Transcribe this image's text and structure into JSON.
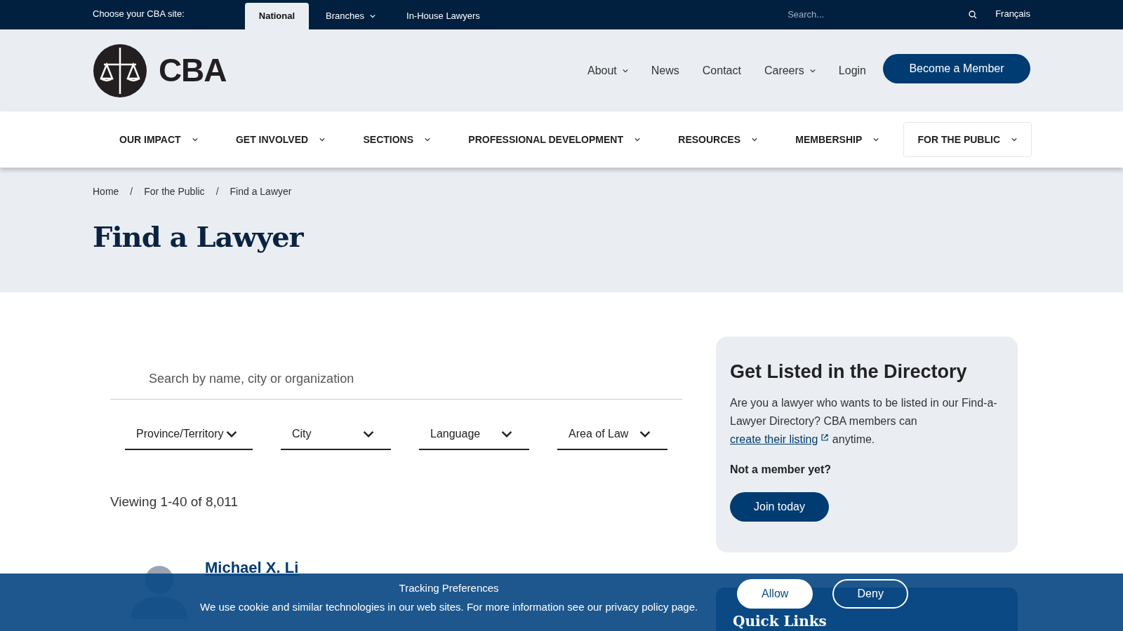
{
  "site_bar": {
    "label": "Choose your CBA site:",
    "sites": [
      {
        "label": "National",
        "selected": true,
        "has_menu": false
      },
      {
        "label": "Branches",
        "selected": false,
        "has_menu": true
      },
      {
        "label": "In-House Lawyers",
        "selected": false,
        "has_menu": false
      }
    ],
    "search": {
      "placeholder": "Search..."
    },
    "language": "Français"
  },
  "header": {
    "logo_text": "CBA",
    "links": [
      {
        "label": "About",
        "has_menu": true
      },
      {
        "label": "News",
        "has_menu": false
      },
      {
        "label": "Contact",
        "has_menu": false
      },
      {
        "label": "Careers",
        "has_menu": true
      },
      {
        "label": "Login",
        "has_menu": false
      }
    ],
    "cta": "Become a Member"
  },
  "main_nav": [
    {
      "label": "OUR IMPACT",
      "selected": false
    },
    {
      "label": "GET INVOLVED",
      "selected": false
    },
    {
      "label": "SECTIONS",
      "selected": false
    },
    {
      "label": "PROFESSIONAL DEVELOPMENT",
      "selected": false
    },
    {
      "label": "RESOURCES",
      "selected": false
    },
    {
      "label": "MEMBERSHIP",
      "selected": false
    },
    {
      "label": "FOR THE PUBLIC",
      "selected": true
    }
  ],
  "breadcrumbs": [
    "Home",
    "For the Public",
    "Find a Lawyer"
  ],
  "breadcrumb_separator": "/",
  "page_title": "Find a Lawyer",
  "search": {
    "placeholder": "Search by name, city or organization"
  },
  "filters": [
    "Province/Territory",
    "City",
    "Language",
    "Area of Law"
  ],
  "results_count": "Viewing 1-40 of 8,011",
  "results": [
    {
      "name": "Michael X. Li"
    }
  ],
  "directory_card": {
    "title": "Get Listed in the Directory",
    "text_before": "Are you a lawyer who wants to be listed in our Find-a-Lawyer Directory? CBA members can",
    "link": "create their listing",
    "text_after": "anytime.",
    "prompt": "Not a member yet?",
    "button": "Join today"
  },
  "quick_links": {
    "title": "Quick Links"
  },
  "cookie_banner": {
    "title": "Tracking Preferences",
    "text": "We use cookie and similar technologies in our web sites. For more information see our privacy policy page.",
    "buttons": [
      {
        "label": "Allow",
        "kind": "primary"
      },
      {
        "label": "Deny",
        "kind": "outline"
      }
    ]
  }
}
